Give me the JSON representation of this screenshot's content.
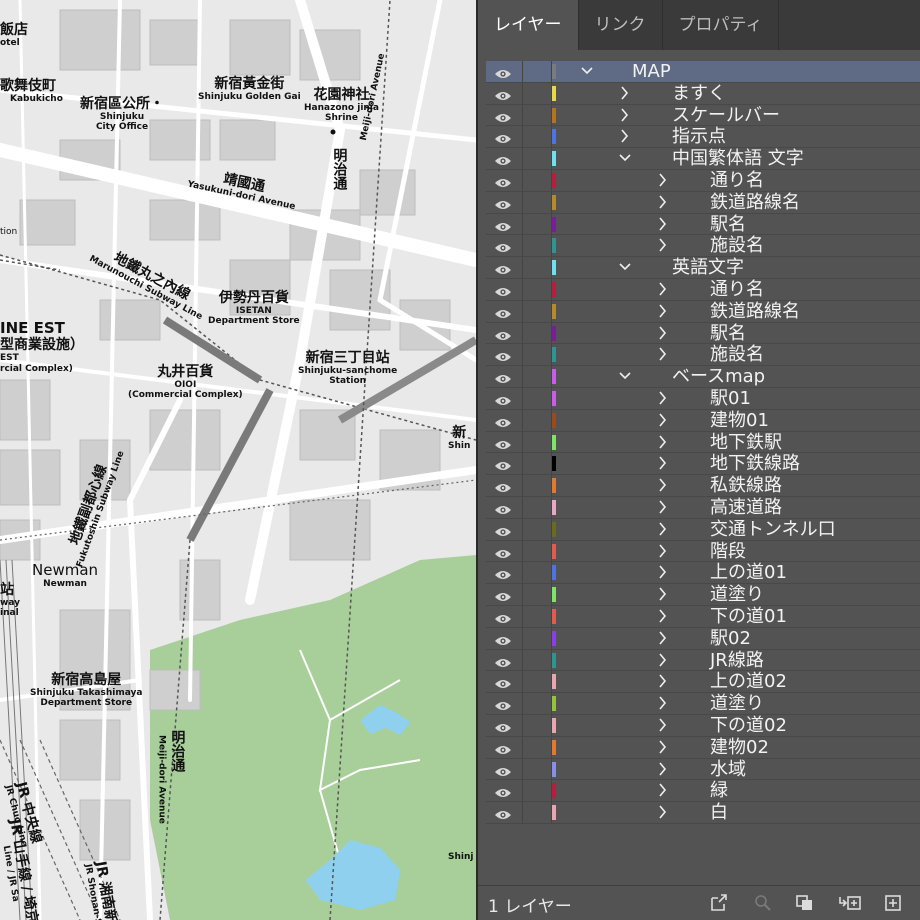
{
  "panel": {
    "tabs": [
      {
        "label": "レイヤー",
        "active": true
      },
      {
        "label": "リンク",
        "active": false
      },
      {
        "label": "プロパティ",
        "active": false
      }
    ],
    "layers": [
      {
        "name": "MAP",
        "level": 0,
        "expanded": true,
        "color": "#7b7b7b",
        "selected": true
      },
      {
        "name": "ますく",
        "level": 1,
        "expanded": false,
        "color": "#e6d84a"
      },
      {
        "name": "スケールバー",
        "level": 1,
        "expanded": false,
        "color": "#b4741e"
      },
      {
        "name": "指示点",
        "level": 1,
        "expanded": false,
        "color": "#4e74e3"
      },
      {
        "name": "中国繁体語 文字",
        "level": 1,
        "expanded": true,
        "color": "#6fe0f0"
      },
      {
        "name": "通り名",
        "level": 2,
        "expanded": false,
        "color": "#b81d3c"
      },
      {
        "name": "鉄道路線名",
        "level": 2,
        "expanded": false,
        "color": "#b58a2a"
      },
      {
        "name": "駅名",
        "level": 2,
        "expanded": false,
        "color": "#7a1d9c"
      },
      {
        "name": "施設名",
        "level": 2,
        "expanded": false,
        "color": "#2d9693"
      },
      {
        "name": "英語文字",
        "level": 1,
        "expanded": true,
        "color": "#6fe0f0"
      },
      {
        "name": "通り名",
        "level": 2,
        "expanded": false,
        "color": "#b81d3c"
      },
      {
        "name": "鉄道路線名",
        "level": 2,
        "expanded": false,
        "color": "#b58a2a"
      },
      {
        "name": "駅名",
        "level": 2,
        "expanded": false,
        "color": "#7a1d9c"
      },
      {
        "name": "施設名",
        "level": 2,
        "expanded": false,
        "color": "#2d9693"
      },
      {
        "name": "ベースmap",
        "level": 1,
        "expanded": true,
        "color": "#c95ce8"
      },
      {
        "name": "駅01",
        "level": 2,
        "expanded": false,
        "color": "#c95ce8"
      },
      {
        "name": "建物01",
        "level": 2,
        "expanded": false,
        "color": "#9c4a1c"
      },
      {
        "name": "地下鉄駅",
        "level": 2,
        "expanded": false,
        "color": "#7fe36a"
      },
      {
        "name": "地下鉄線路",
        "level": 2,
        "expanded": false,
        "color": "#000000"
      },
      {
        "name": "私鉄線路",
        "level": 2,
        "expanded": false,
        "color": "#e3782e"
      },
      {
        "name": "高速道路",
        "level": 2,
        "expanded": false,
        "color": "#e9a6c6"
      },
      {
        "name": "交通トンネル口",
        "level": 2,
        "expanded": false,
        "color": "#6b6a1d"
      },
      {
        "name": "階段",
        "level": 2,
        "expanded": false,
        "color": "#e35a4e"
      },
      {
        "name": "上の道01",
        "level": 2,
        "expanded": false,
        "color": "#4e74e3"
      },
      {
        "name": "道塗り",
        "level": 2,
        "expanded": false,
        "color": "#7fe36a"
      },
      {
        "name": "下の道01",
        "level": 2,
        "expanded": false,
        "color": "#e35a4e"
      },
      {
        "name": "駅02",
        "level": 2,
        "expanded": false,
        "color": "#8a3ee8"
      },
      {
        "name": "JR線路",
        "level": 2,
        "expanded": false,
        "color": "#2d9693"
      },
      {
        "name": "上の道02",
        "level": 2,
        "expanded": false,
        "color": "#e9a6b0"
      },
      {
        "name": "道塗り",
        "level": 2,
        "expanded": false,
        "color": "#93c43a"
      },
      {
        "name": "下の道02",
        "level": 2,
        "expanded": false,
        "color": "#e9a6b0"
      },
      {
        "name": "建物02",
        "level": 2,
        "expanded": false,
        "color": "#e3782e"
      },
      {
        "name": "水域",
        "level": 2,
        "expanded": false,
        "color": "#8a8ee8"
      },
      {
        "name": "緑",
        "level": 2,
        "expanded": false,
        "color": "#b81d3c"
      },
      {
        "name": "白",
        "level": 2,
        "expanded": false,
        "color": "#e9a6b0"
      }
    ],
    "footer": {
      "count_label": "1 レイヤー",
      "icons": [
        "export-icon",
        "search-icon",
        "collect-icon",
        "new-sublayer-icon",
        "new-layer-icon"
      ]
    }
  },
  "map": {
    "labels": {
      "hotel_jp": "飯店",
      "hotel_en": "otel",
      "kabukicho_jp": "歌舞伎町",
      "kabukicho_en": "Kabukicho",
      "ward_office_jp": "新宿區公所・",
      "ward_office_en": "Shinjuku\nCity Office",
      "golden_gai_jp": "新宿黃金街",
      "golden_gai_en": "Shinjuku Golden Gai",
      "hanazono_jp": "花園神社",
      "hanazono_en": "Hanazono jinja\nShrine",
      "meiji_ave_jp": "明治通",
      "meiji_ave_en": "Meiji-dori Avenue",
      "yasukuni_jp": "靖國通",
      "yasukuni_en": "Yasukuni-dori Avenue",
      "marunouchi_jp": "地鐵丸之內線",
      "marunouchi_en": "Marunouchi Subway Line",
      "isetan_jp": "伊勢丹百貨",
      "isetan_en": "ISETAN\nDepartment Store",
      "lumine_jp": "INE EST",
      "lumine_jp2": "型商業設施）",
      "lumine_en": "EST\nrcial Complex)",
      "oioi_jp": "丸井百貨",
      "oioi_en": "OIOI\n(Commercial Complex)",
      "sanchome_jp": "新宿三丁目站",
      "sanchome_en": "Shinjuku-sanchome\nStation",
      "fukutoshin_jp": "地鐵副都心線",
      "fukutoshin_en": "Fukutoshin Subway Line",
      "newman_jp": "Newman",
      "newman_en": "Newman",
      "takashimaya_jp": "新宿高島屋",
      "takashimaya_en": "Shinjuku Takashimaya\nDepartment Store",
      "meiji_ave2_jp": "明治通",
      "meiji_ave2_en": "Meiji-dori Avenue",
      "jr_chuo_jp": "JR 中央線",
      "jr_chuo_en": "JR Chuo Line",
      "jr_yamanote_jp": "JR 山手線 / 埼京",
      "jr_yamanote_en": "Line / JR Sa",
      "jr_shonan_jp": "JR 湘南新",
      "jr_shonan_en": "JR Shonan-S",
      "station_left_jp": "站",
      "station_left_en": "way\ninal",
      "tion": "tion",
      "shinj": "Shinj",
      "shinj_jp": "新",
      "shinj_en": "Shin"
    }
  }
}
